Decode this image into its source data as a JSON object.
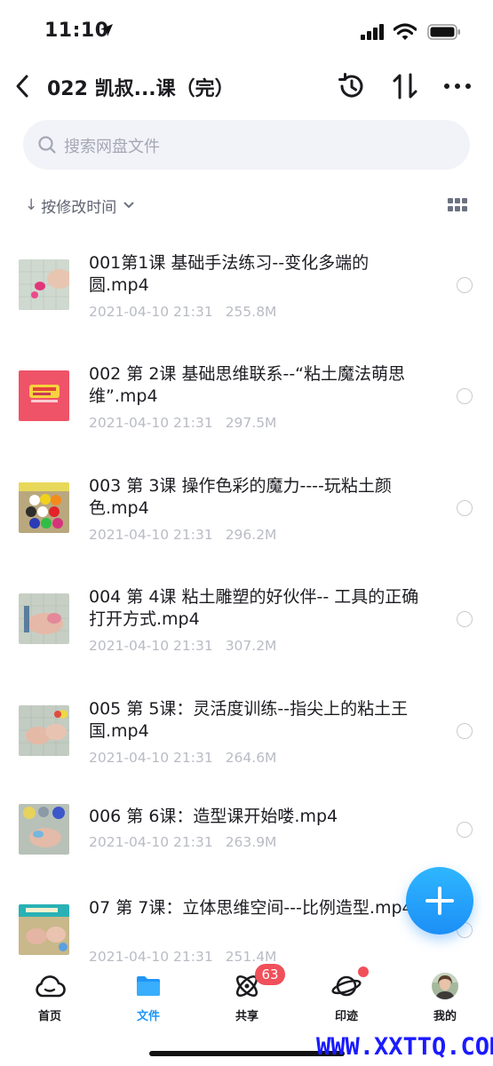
{
  "status_bar": {
    "time": "11:10"
  },
  "header": {
    "title": "022 凯叔...课（完）"
  },
  "search": {
    "placeholder": "搜索网盘文件"
  },
  "sort": {
    "arrow": "↓",
    "label": "按修改时间"
  },
  "files": [
    {
      "name": "001第1课 基础手法练习--变化多端的圆.mp4",
      "date": "2021-04-10 21:31",
      "size": "255.8M"
    },
    {
      "name": "002 第 2课 基础思维联系--“粘土魔法萌思维”.mp4",
      "date": "2021-04-10 21:31",
      "size": "297.5M"
    },
    {
      "name": "003 第 3课  操作色彩的魔力----玩粘土颜色.mp4",
      "date": "2021-04-10 21:31",
      "size": "296.2M"
    },
    {
      "name": "004 第 4课  粘土雕塑的好伙伴--  工具的正确打开方式.mp4",
      "date": "2021-04-10 21:31",
      "size": "307.2M"
    },
    {
      "name": "005  第 5课：灵活度训练--指尖上的粘土王国.mp4",
      "date": "2021-04-10 21:31",
      "size": "264.6M"
    },
    {
      "name": "006  第 6课：造型课开始喽.mp4",
      "date": "2021-04-10 21:31",
      "size": "263.9M"
    },
    {
      "name": "07 第 7课：立体思维空间---比例造型.mp4",
      "date": "2021-04-10 21:31",
      "size": "251.4M"
    }
  ],
  "tabs": [
    {
      "label": "首页",
      "icon": "cloud-icon"
    },
    {
      "label": "文件",
      "icon": "folder-icon"
    },
    {
      "label": "共享",
      "icon": "atom-icon"
    },
    {
      "label": "印迹",
      "icon": "planet-icon"
    },
    {
      "label": "我的",
      "icon": "avatar"
    }
  ],
  "badges": {
    "share_count": "63"
  },
  "watermark": "WWW.XXTTQ.COM",
  "colors": {
    "accent": "#1e96f7",
    "badge": "#f0505a",
    "fab": "#2aa8fb"
  }
}
